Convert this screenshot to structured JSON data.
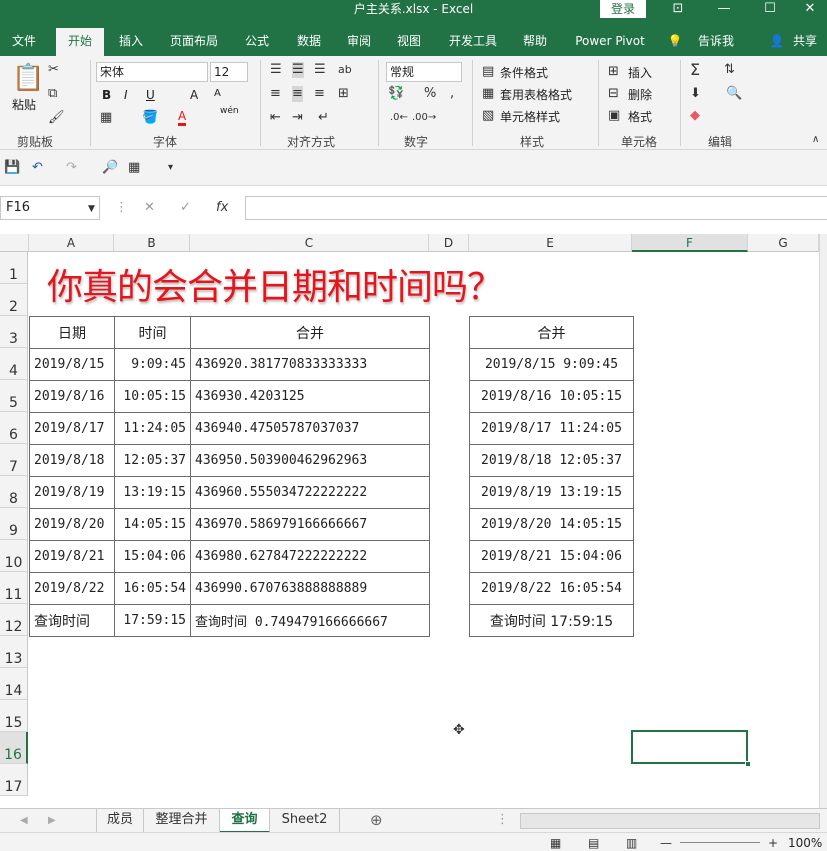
{
  "window": {
    "title": "户主关系.xlsx  -  Excel",
    "signin": "登录"
  },
  "ribbon": {
    "tabs": [
      "文件",
      "开始",
      "插入",
      "页面布局",
      "公式",
      "数据",
      "审阅",
      "视图",
      "开发工具",
      "帮助",
      "Power Pivot",
      "告诉我",
      "共享"
    ],
    "active_tab": "开始",
    "clipboard": {
      "paste": "粘贴",
      "label": "剪贴板"
    },
    "font": {
      "name": "宋体",
      "size": "12",
      "label": "字体",
      "bold": "B",
      "italic": "I",
      "underline": "U",
      "grow": "A",
      "shrink": "A",
      "color_a": "A",
      "phonetic": "wén"
    },
    "alignment": {
      "label": "对齐方式"
    },
    "number": {
      "format": "常规",
      "label": "数字"
    },
    "styles": {
      "conditional": "条件格式",
      "table": "套用表格格式",
      "cell": "单元格样式",
      "label": "样式"
    },
    "cells": {
      "insert": "插入",
      "delete": "删除",
      "format": "格式",
      "label": "单元格"
    },
    "editing": {
      "label": "编辑"
    }
  },
  "formula_bar": {
    "name_box": "F16",
    "fx": "fx",
    "value": ""
  },
  "grid": {
    "columns": [
      "A",
      "B",
      "C",
      "D",
      "E",
      "F",
      "G"
    ],
    "selected_column": "F",
    "rows": [
      "1",
      "2",
      "3",
      "4",
      "5",
      "6",
      "7",
      "8",
      "9",
      "10",
      "11",
      "12",
      "13",
      "14",
      "15",
      "16",
      "17"
    ],
    "selected_row": "16",
    "title": "你真的会合并日期和时间吗？",
    "left_table": {
      "headers": [
        "日期",
        "时间",
        "合并"
      ],
      "rows": [
        [
          "2019/8/15",
          "9:09:45",
          "436920.381770833333333"
        ],
        [
          "2019/8/16",
          "10:05:15",
          "436930.4203125"
        ],
        [
          "2019/8/17",
          "11:24:05",
          "436940.47505787037037"
        ],
        [
          "2019/8/18",
          "12:05:37",
          "436950.503900462962963"
        ],
        [
          "2019/8/19",
          "13:19:15",
          "436960.555034722222222"
        ],
        [
          "2019/8/20",
          "14:05:15",
          "436970.586979166666667"
        ],
        [
          "2019/8/21",
          "15:04:06",
          "436980.627847222222222"
        ],
        [
          "2019/8/22",
          "16:05:54",
          "436990.670763888888889"
        ],
        [
          "查询时间",
          "17:59:15",
          "查询时间 0.749479166666667"
        ]
      ]
    },
    "right_table": {
      "header": "合并",
      "rows": [
        "2019/8/15 9:09:45",
        "2019/8/16 10:05:15",
        "2019/8/17 11:24:05",
        "2019/8/18 12:05:37",
        "2019/8/19 13:19:15",
        "2019/8/20 14:05:15",
        "2019/8/21 15:04:06",
        "2019/8/22 16:05:54",
        "查询时间 17:59:15"
      ]
    }
  },
  "sheets": {
    "tabs": [
      "成员",
      "整理合并",
      "查询",
      "Sheet2"
    ],
    "active": "查询"
  },
  "status": {
    "zoom": "100%"
  },
  "colors": {
    "excel_green": "#217346",
    "title_red": "#e8141b"
  }
}
